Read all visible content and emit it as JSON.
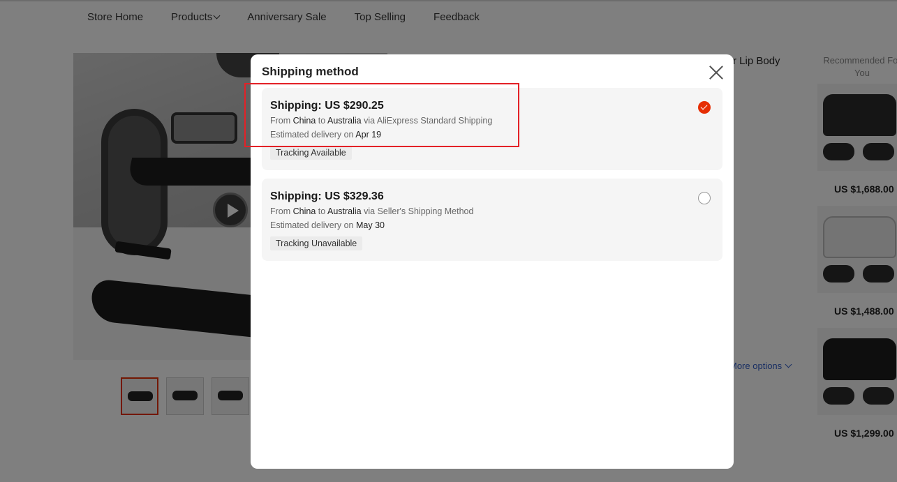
{
  "nav": {
    "items": [
      {
        "label": "Store Home"
      },
      {
        "label": "Products"
      },
      {
        "label": "Anniversary Sale"
      },
      {
        "label": "Top Selling"
      },
      {
        "label": "Feedback"
      }
    ]
  },
  "product": {
    "title_fragment": "r Lip Body",
    "more_options": "More options"
  },
  "recommended": {
    "title": "Recommended For You",
    "items": [
      {
        "price": "US $1,688.00"
      },
      {
        "price": "US $1,488.00"
      },
      {
        "price": "US $1,299.00"
      }
    ]
  },
  "modal": {
    "title": "Shipping method",
    "options": [
      {
        "price": "Shipping: US $290.25",
        "from_prefix": "From ",
        "from": "China",
        "to_prefix": " to ",
        "to": "Australia",
        "via_prefix": " via ",
        "via": "AliExpress Standard Shipping",
        "delivery_prefix": "Estimated delivery on ",
        "delivery_date": "Apr 19",
        "tracking": "Tracking Available",
        "selected": true
      },
      {
        "price": "Shipping: US $329.36",
        "from_prefix": "From ",
        "from": "China",
        "to_prefix": " to ",
        "to": "Australia",
        "via_prefix": " via ",
        "via": "Seller's Shipping Method",
        "delivery_prefix": "Estimated delivery on ",
        "delivery_date": "May 30",
        "tracking": "Tracking Unavailable",
        "selected": false
      }
    ]
  },
  "colors": {
    "accent": "#e62e04",
    "highlight": "#e32127",
    "link": "#2e5bc5"
  }
}
